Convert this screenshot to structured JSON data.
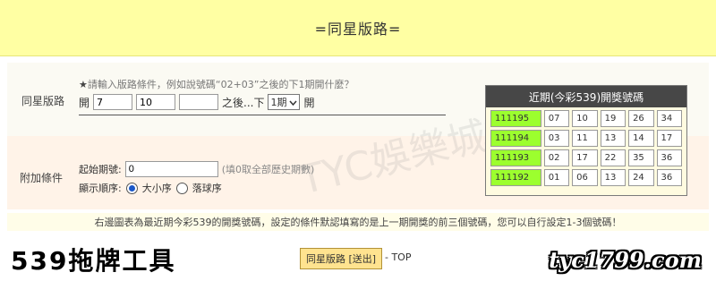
{
  "header": {
    "title": "=同星版路="
  },
  "tail": {
    "label": "同星版路",
    "hint": "請輸入版路條件，例如說號碼“02+03”之後的下1期開什麼？",
    "hint_star": "★",
    "open_label": "開",
    "inputs": [
      "7",
      "10",
      ""
    ],
    "after_label": "之後...下",
    "period_select": "1期",
    "open_label_end": "開"
  },
  "extra": {
    "label": "附加條件",
    "start_label": "起始期號:",
    "start_value": "0",
    "start_hint": "(填0取全部歷史期數)",
    "order_label": "顯示順序:",
    "order_options": [
      "大小序",
      "落球序"
    ],
    "order_selected": "大小序"
  },
  "recent": {
    "title": "近期(今彩539)開獎號碼",
    "draws": [
      {
        "period": "111195",
        "numbers": [
          "07",
          "10",
          "19",
          "26",
          "34"
        ]
      },
      {
        "period": "111194",
        "numbers": [
          "03",
          "11",
          "13",
          "14",
          "17"
        ]
      },
      {
        "period": "111193",
        "numbers": [
          "02",
          "17",
          "22",
          "35",
          "36"
        ]
      },
      {
        "period": "111192",
        "numbers": [
          "01",
          "06",
          "13",
          "24",
          "36"
        ]
      }
    ]
  },
  "note": "右邊圖表為最近期今彩539的開獎號碼，設定的條件默認填寫的是上一期開獎的前三個號碼，您可以自行設定1-3個號碼！",
  "footer": {
    "brand_left": "539拖牌工具",
    "submit_label": "同星版路 [送出]",
    "top_link": "- TOP",
    "brand_right": "tyc1799.com"
  },
  "watermark": "TYC娛樂城提供",
  "colors": {
    "header_bg": "#ffffa3",
    "period_cell": "#9cff2e",
    "panel_header": "#474747",
    "submit_bg": "#ffe38f"
  }
}
